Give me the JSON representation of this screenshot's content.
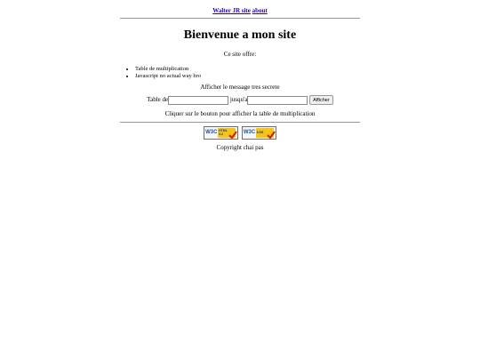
{
  "nav": {
    "home_link": "Walter JR site",
    "about_link": "about"
  },
  "main": {
    "title": "Bienvenue a mon site",
    "offer_text": "Ce site offre:",
    "features": [
      "Table de multiplication",
      "Javascript no actual way bro"
    ],
    "secret_text": "Afficher le message tres secrete"
  },
  "form": {
    "table_label": "Table de",
    "until_label": "jusqu'a",
    "table_value": "",
    "until_value": "",
    "submit_label": "Afficher",
    "instructions": "Cliquer sur le bouton pour afficher la table de multiplication"
  },
  "badges": [
    {
      "logo": "W3C",
      "line1": "HTML",
      "line2": "3.2",
      "icon": "check-icon"
    },
    {
      "logo": "W3C",
      "line1": "css",
      "line2": "",
      "icon": "check-icon"
    }
  ],
  "footer": {
    "copyright": "Copyright chai pas"
  },
  "colors": {
    "link": "#2200cc",
    "badge_gold": "#f5c419",
    "check_red": "#cc2200",
    "w3c_blue": "#1a4f9c"
  }
}
